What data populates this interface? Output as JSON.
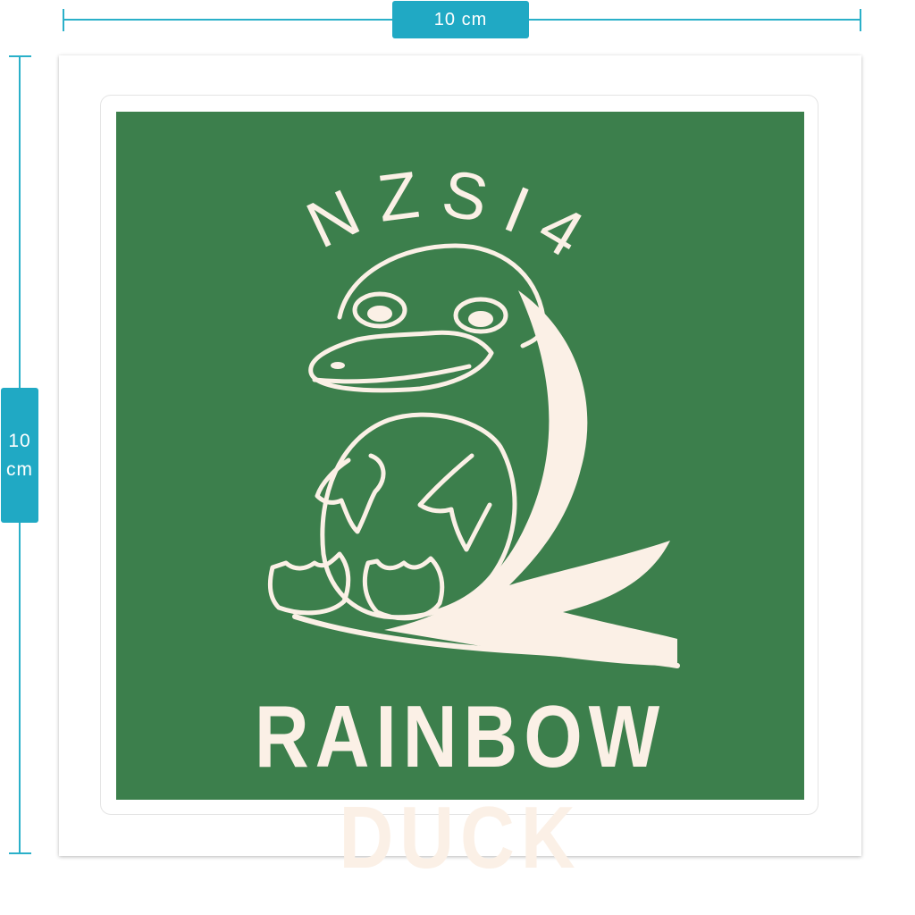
{
  "dimensions": {
    "width_label": "10 cm",
    "height_value": "10",
    "height_unit": "cm",
    "accent_color": "#20a9c4"
  },
  "sticker": {
    "background_color": "#3c7f4c",
    "ink_color": "#fbf0e6",
    "top_text": "NZSI4",
    "bottom_text": "RAINBOW DUCK",
    "illustration": "platypus-illustration"
  }
}
